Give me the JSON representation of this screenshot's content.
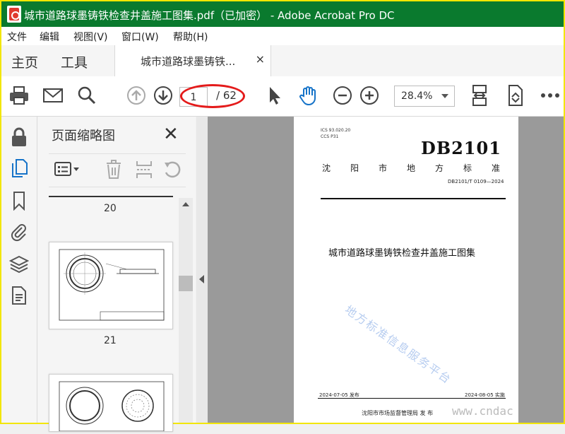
{
  "window": {
    "title": "城市道路球墨铸铁检查井盖施工图集.pdf（已加密） - Adobe Acrobat Pro DC"
  },
  "menu": [
    "文件",
    "编辑",
    "视图(V)",
    "窗口(W)",
    "帮助(H)"
  ],
  "tabs": {
    "home": "主页",
    "tools": "工具",
    "document": "城市道路球墨铸铁...",
    "close_glyph": "×"
  },
  "toolbar": {
    "page_current": "1",
    "page_total": "/ 62",
    "zoom": "28.4%"
  },
  "thumbnails": {
    "title": "页面缩略图",
    "close_glyph": "✕",
    "labels": [
      "20",
      "21"
    ]
  },
  "page": {
    "ics": "ICS 93.020.20",
    "ccs": "CCS P31",
    "standard": "DB2101",
    "city_chars": [
      "沈",
      "阳",
      "市",
      "地",
      "方",
      "标",
      "准"
    ],
    "code": "DB2101/T 0109—2024",
    "title": "城市道路球墨铸铁检查井盖施工图集",
    "watermark": "地方标准信息服务平台",
    "release_date": "2024-07-05 发布",
    "effective_date": "2024-08-05 实施",
    "issuer": "沈阳市市场监督管理局    发 布"
  },
  "site_watermark": "www.cndac"
}
